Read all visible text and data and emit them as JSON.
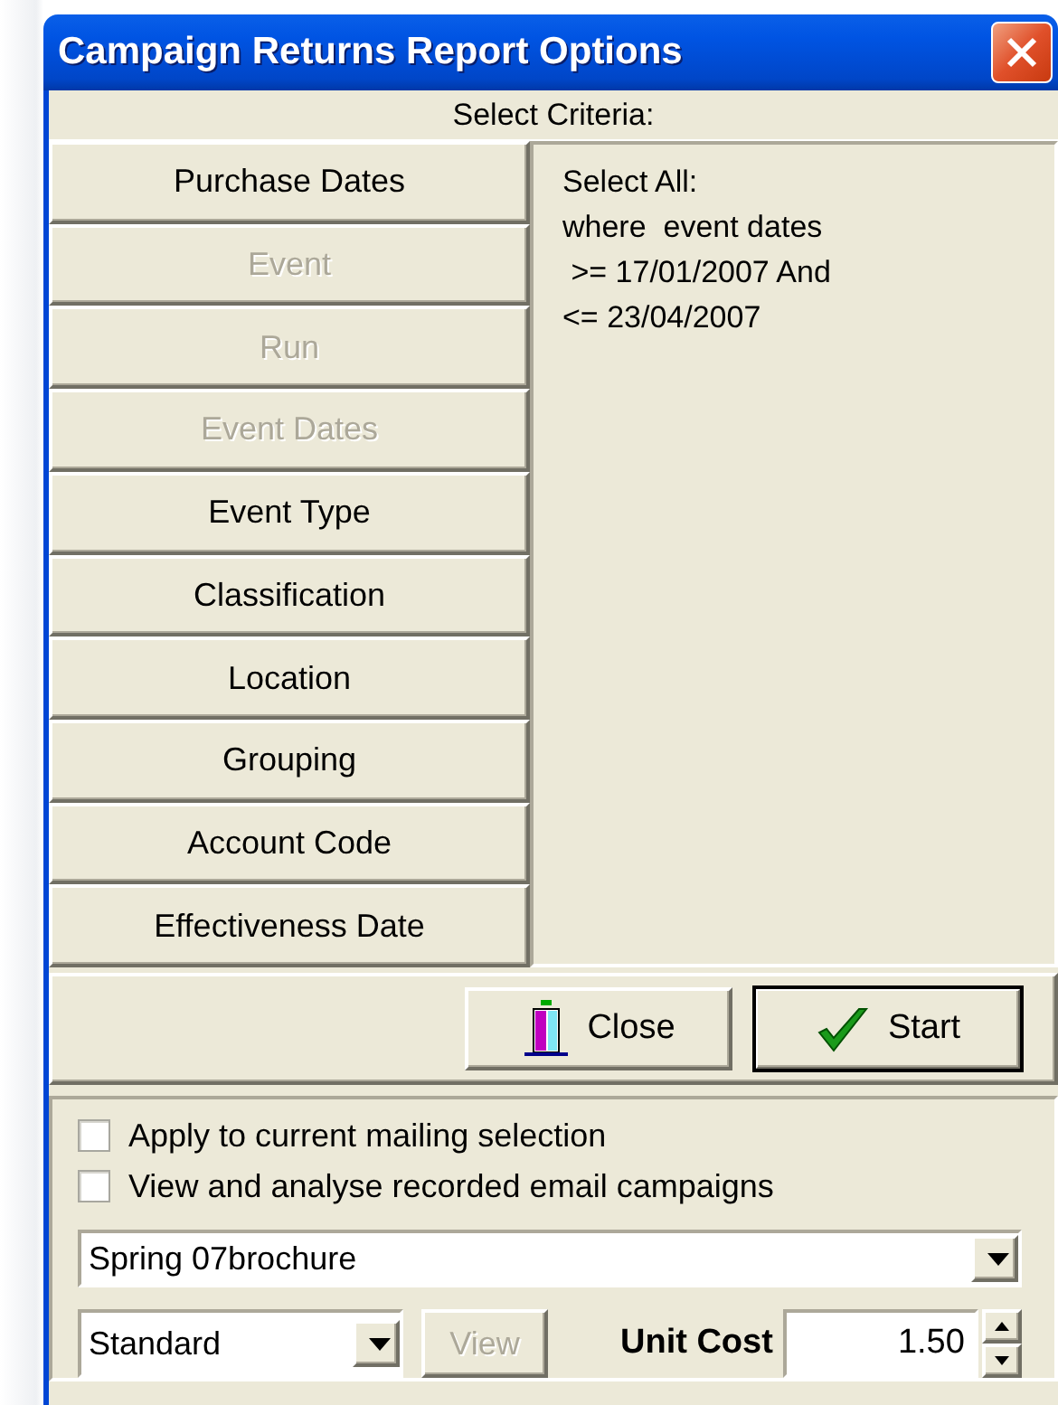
{
  "window": {
    "title": "Campaign Returns Report Options"
  },
  "criteria": {
    "heading": "Select Criteria:",
    "buttons": [
      {
        "label": "Purchase Dates",
        "disabled": false
      },
      {
        "label": "Event",
        "disabled": true
      },
      {
        "label": "Run",
        "disabled": true
      },
      {
        "label": "Event Dates",
        "disabled": true
      },
      {
        "label": "Event Type",
        "disabled": false
      },
      {
        "label": "Classification",
        "disabled": false
      },
      {
        "label": "Location",
        "disabled": false
      },
      {
        "label": "Grouping",
        "disabled": false
      },
      {
        "label": "Account Code",
        "disabled": false
      },
      {
        "label": "Effectiveness Date",
        "disabled": false
      }
    ],
    "summary": [
      "Select All:",
      "where  event dates",
      " >= 17/01/2007 And",
      "<= 23/04/2007"
    ]
  },
  "actions": [
    {
      "kind": "close",
      "label": "Close",
      "default": false
    },
    {
      "kind": "start",
      "label": "Start",
      "default": true
    }
  ],
  "options": [
    {
      "label": "Apply to current mailing selection",
      "checked": false
    },
    {
      "label": "View and analyse recorded email campaigns",
      "checked": false
    }
  ],
  "campaign": {
    "value": "Spring 07brochure"
  },
  "type": {
    "value": "Standard"
  },
  "view_button": {
    "label": "View",
    "disabled": true
  },
  "unit_cost": {
    "label": "Unit Cost",
    "value": "1.50"
  }
}
